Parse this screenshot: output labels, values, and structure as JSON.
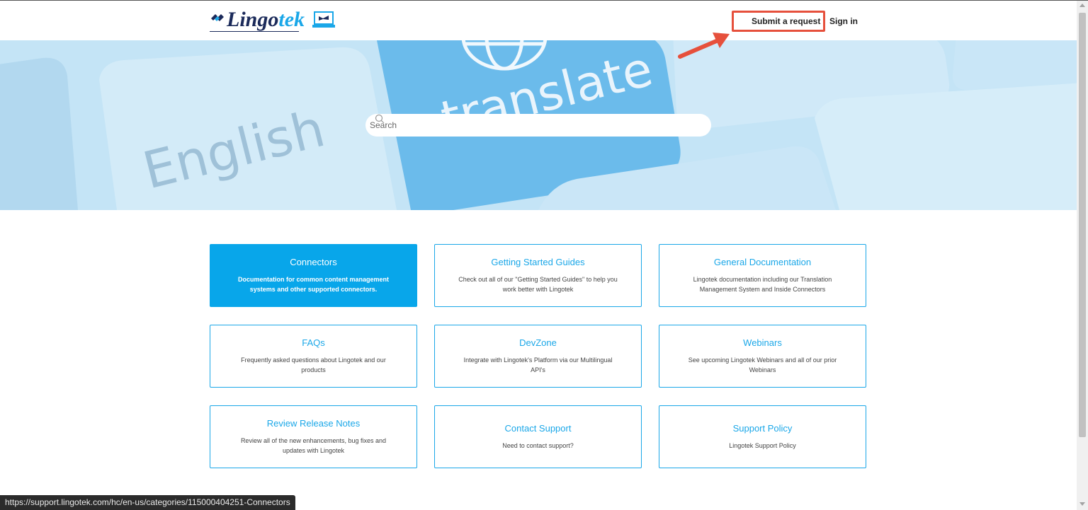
{
  "header": {
    "logo_text_main": "Lingo",
    "logo_text_accent": "tek",
    "logo_icon": "laptop-icon",
    "nav": {
      "submit_request": "Submit a request",
      "sign_in": "Sign in"
    },
    "annotation_color": "#e6503c"
  },
  "hero": {
    "key_text_left": "English",
    "key_text_center": "translate",
    "search": {
      "placeholder": "Search",
      "icon": "search-icon"
    }
  },
  "cards": [
    {
      "title": "Connectors",
      "desc": "Documentation for common content management systems and other supported connectors.",
      "active": true
    },
    {
      "title": "Getting Started Guides",
      "desc": "Check out all of our \"Getting Started Guides\" to help you work better with Lingotek"
    },
    {
      "title": "General Documentation",
      "desc": "Lingotek documentation including our Translation Management System and Inside Connectors"
    },
    {
      "title": "FAQs",
      "desc": "Frequently asked questions about Lingotek and our products"
    },
    {
      "title": "DevZone",
      "desc": "Integrate with Lingotek's Platform via our Multilingual API's"
    },
    {
      "title": "Webinars",
      "desc": "See upcoming Lingotek Webinars and all of our prior Webinars"
    },
    {
      "title": "Review Release Notes",
      "desc": "Review all of the new enhancements, bug fixes and updates with Lingotek"
    },
    {
      "title": "Contact Support",
      "desc": "Need to contact support?"
    },
    {
      "title": "Support Policy",
      "desc": "Lingotek Support Policy"
    }
  ],
  "statusbar": {
    "url": "https://support.lingotek.com/hc/en-us/categories/115000404251-Connectors"
  },
  "colors": {
    "accent": "#1aa7e8",
    "active_card": "#08a6ea",
    "brand_dark": "#1b2a5a",
    "hero_bg": "#bfe1f5"
  }
}
